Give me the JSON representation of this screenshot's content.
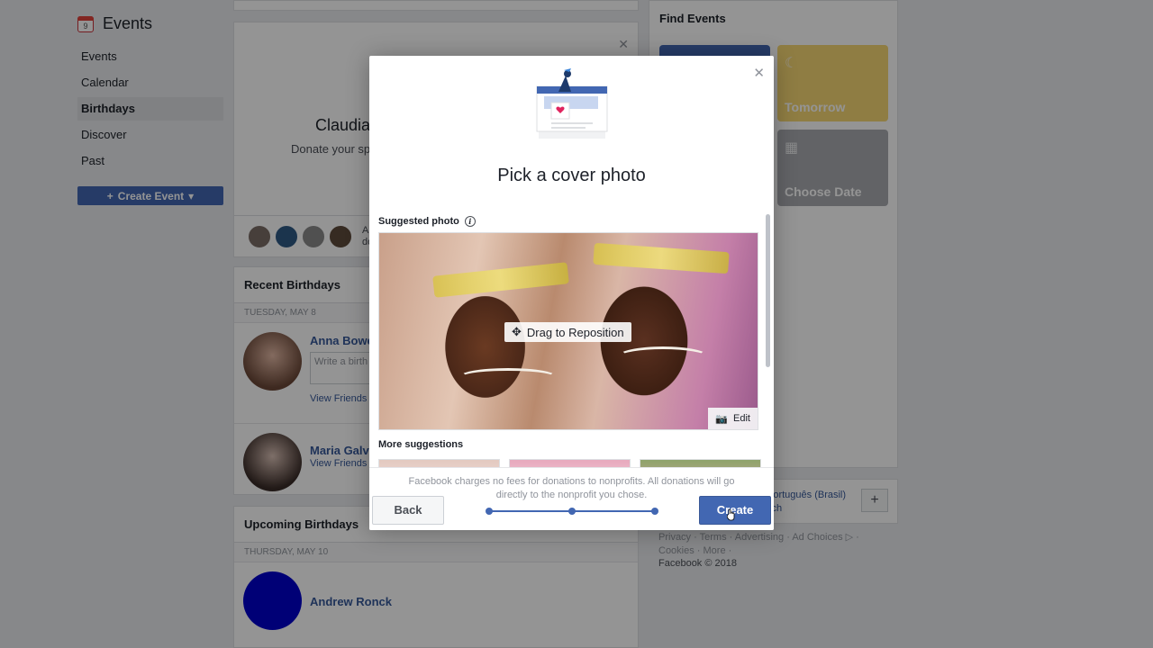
{
  "leftnav": {
    "title": "Events",
    "calendar_day": "9",
    "items": [
      {
        "label": "Events"
      },
      {
        "label": "Calendar"
      },
      {
        "label": "Birthdays"
      },
      {
        "label": "Discover"
      },
      {
        "label": "Past"
      }
    ],
    "create_event_label": "Create Event"
  },
  "donate": {
    "name": "Claudia",
    "sub": "Donate your sp",
    "foot_text_line1": "Al",
    "foot_text_line2": "do"
  },
  "recent": {
    "heading": "Recent Birthdays",
    "date_1": "Tuesday, May 8",
    "person_1": "Anna Bowe",
    "post_placeholder": "Write a birth",
    "view_friends": "View Friends",
    "person_2": "Maria Galv",
    "view_friends_2": "View Friends"
  },
  "upcoming": {
    "heading": "Upcoming Birthdays",
    "date_1": "Thursday, May 10",
    "person_1": "Andrew Ronck"
  },
  "find_events": {
    "heading": "Find Events",
    "tiles": [
      {
        "label": "Tomorrow",
        "color": "#f7d774"
      },
      {
        "label": "Choose Date",
        "color": "#a9abb0"
      }
    ]
  },
  "languages": {
    "line1": "Português (Brasil)",
    "line2": "sch"
  },
  "footer": {
    "links": "Privacy · Terms · Advertising · Ad Choices ▷ · Cookies · More ·",
    "copyright": "Facebook © 2018"
  },
  "modal": {
    "title": "Pick a cover photo",
    "suggested_label": "Suggested photo",
    "drag_label": "Drag to Reposition",
    "edit_label": "Edit",
    "more_label": "More suggestions",
    "fee_note": "Facebook charges no fees for donations to nonprofits. All donations will go directly to the nonprofit you chose.",
    "back_label": "Back",
    "create_label": "Create"
  },
  "colors": {
    "brand": "#4267b2",
    "link": "#365899"
  }
}
